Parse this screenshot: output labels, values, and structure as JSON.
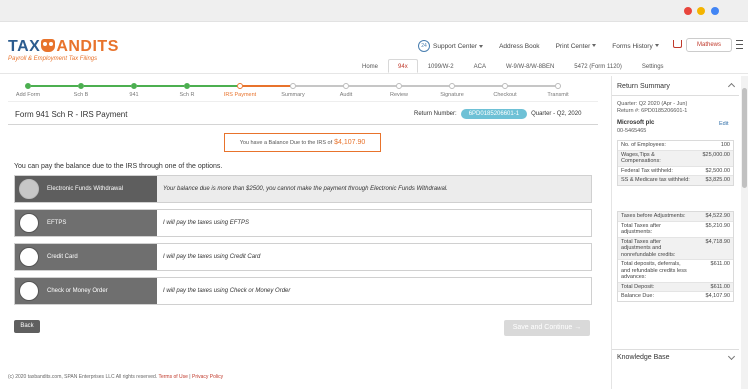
{
  "header": {
    "logo_prefix": "TAX",
    "logo_suffix": "ANDITS",
    "logo_tagline": "Payroll & Employment Tax Filings",
    "support_label": "Support Center",
    "address_book": "Address Book",
    "print_center": "Print Center",
    "forms_history": "Forms History",
    "user_name": "Mathews"
  },
  "nav_tabs": [
    "Home",
    "94x",
    "1099/W-2",
    "ACA",
    "W-9/W-8/W-8BEN",
    "5472 (Form 1120)",
    "Settings"
  ],
  "nav_active": "94x",
  "steps": [
    {
      "label": "Add Form",
      "state": "done"
    },
    {
      "label": "Sch B",
      "state": "done"
    },
    {
      "label": "941",
      "state": "done"
    },
    {
      "label": "Sch R",
      "state": "done"
    },
    {
      "label": "IRS Payment",
      "state": "current"
    },
    {
      "label": "Summary",
      "state": "todo"
    },
    {
      "label": "Audit",
      "state": "todo"
    },
    {
      "label": "Review",
      "state": "todo"
    },
    {
      "label": "Signature",
      "state": "todo"
    },
    {
      "label": "Checkout",
      "state": "todo"
    },
    {
      "label": "Transmit",
      "state": "todo"
    }
  ],
  "main": {
    "title": "Form 941 Sch R - IRS Payment",
    "return_label": "Return Number:",
    "return_number": "6PD0185206601-1",
    "quarter": "Quarter - Q2, 2020",
    "balance_text": "You have a Balance Due to the IRS of",
    "balance_amount": "$4,107.90",
    "instructions": "You can pay the balance due to the IRS through one of the options.",
    "options": [
      {
        "label": "Electronic Funds Withdrawal",
        "desc": "Your balance due is more than $2500, you cannot make the payment through Electronic Funds Withdrawal."
      },
      {
        "label": "EFTPS",
        "desc": "I will pay the taxes using EFTPS"
      },
      {
        "label": "Credit Card",
        "desc": "I will pay the taxes using Credit Card"
      },
      {
        "label": "Check or Money Order",
        "desc": "I will pay the taxes using Check or Money Order"
      }
    ],
    "back_label": "Back",
    "continue_label": "Save and Continue"
  },
  "footer": {
    "copyright": "(c) 2020 taxbandits.com, SPAN Enterprises LLC All rights reserved.",
    "terms": "Terms of Use",
    "privacy": "Privacy Policy"
  },
  "summary": {
    "title": "Return Summary",
    "quarter_line": "Quarter: Q2 2020 (Apr - Jun)",
    "return_line": "Return #: 6PD0185206601-1",
    "company": "Microsoft plc",
    "ein": "00-5465465",
    "edit_label": "Edit",
    "rows_top": [
      {
        "label": "No. of Employees:",
        "value": "100"
      },
      {
        "label": "Wages,Tips & Compensations:",
        "value": "$25,000.00"
      },
      {
        "label": "Federal Tax withheld:",
        "value": "$2,500.00"
      },
      {
        "label": "SS & Medicare tax withheld:",
        "value": "$3,825.00"
      }
    ],
    "rows_bottom": [
      {
        "label": "Taxes before Adjustments:",
        "value": "$4,522.90"
      },
      {
        "label": "Total Taxes after adjustments:",
        "value": "$5,210.90"
      },
      {
        "label": "Total Taxes after adjustments and nonrefundable credits:",
        "value": "$4,718.90"
      },
      {
        "label": "Total deposits, deferrals, and refundable credits less advances:",
        "value": "$611.00"
      },
      {
        "label": "Total Deposit:",
        "value": "$611.00"
      },
      {
        "label": "Balance Due:",
        "value": "$4,107.90"
      }
    ],
    "kb_title": "Knowledge Base"
  },
  "colors": {
    "accent": "#e8732c",
    "brand": "#2c5c8f",
    "badge": "#6ec1d6",
    "done": "#4caf50"
  }
}
